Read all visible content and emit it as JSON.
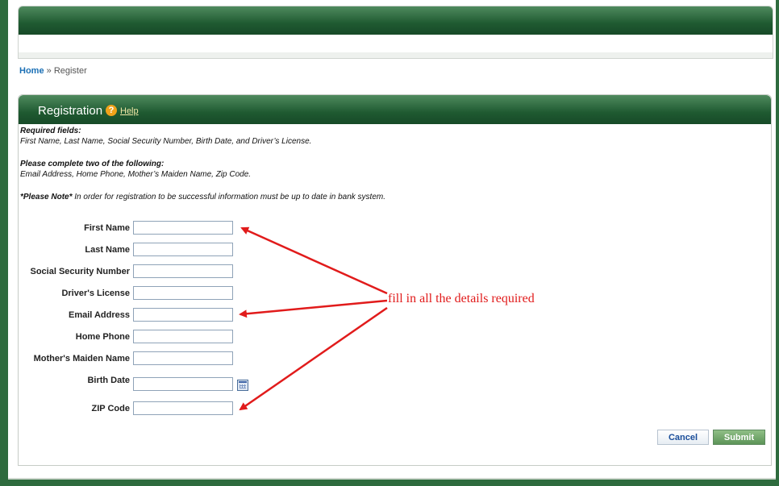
{
  "breadcrumb": {
    "home": "Home",
    "separator": "»",
    "current": "Register"
  },
  "panel": {
    "title": "Registration",
    "help_icon_glyph": "?",
    "help_link": "Help"
  },
  "info": {
    "required_heading": "Required fields:",
    "required_list": "First Name, Last Name, Social Security Number, Birth Date, and Driver’s License.",
    "two_heading": "Please complete two of the following:",
    "two_list": "Email Address, Home Phone, Mother’s Maiden Name, Zip Code.",
    "note_label": "*Please Note*",
    "note_text": " In order for registration to be successful information must be up to date in bank system."
  },
  "form": {
    "first_name": "First Name",
    "last_name": "Last Name",
    "ssn": "Social Security Number",
    "drivers_license": "Driver's License",
    "email": "Email Address",
    "home_phone": "Home Phone",
    "maiden_name": "Mother's Maiden Name",
    "birth_date": "Birth Date",
    "zip": "ZIP Code"
  },
  "buttons": {
    "cancel": "Cancel",
    "submit": "Submit"
  },
  "annotation": "fill in all the details required",
  "icons": {
    "help": "help-icon",
    "calendar": "calendar-icon"
  },
  "colors": {
    "header_green": "#1f5a31",
    "link_blue": "#1a6fb5",
    "annotation_red": "#e11b1b",
    "submit_green": "#6fa36a"
  }
}
